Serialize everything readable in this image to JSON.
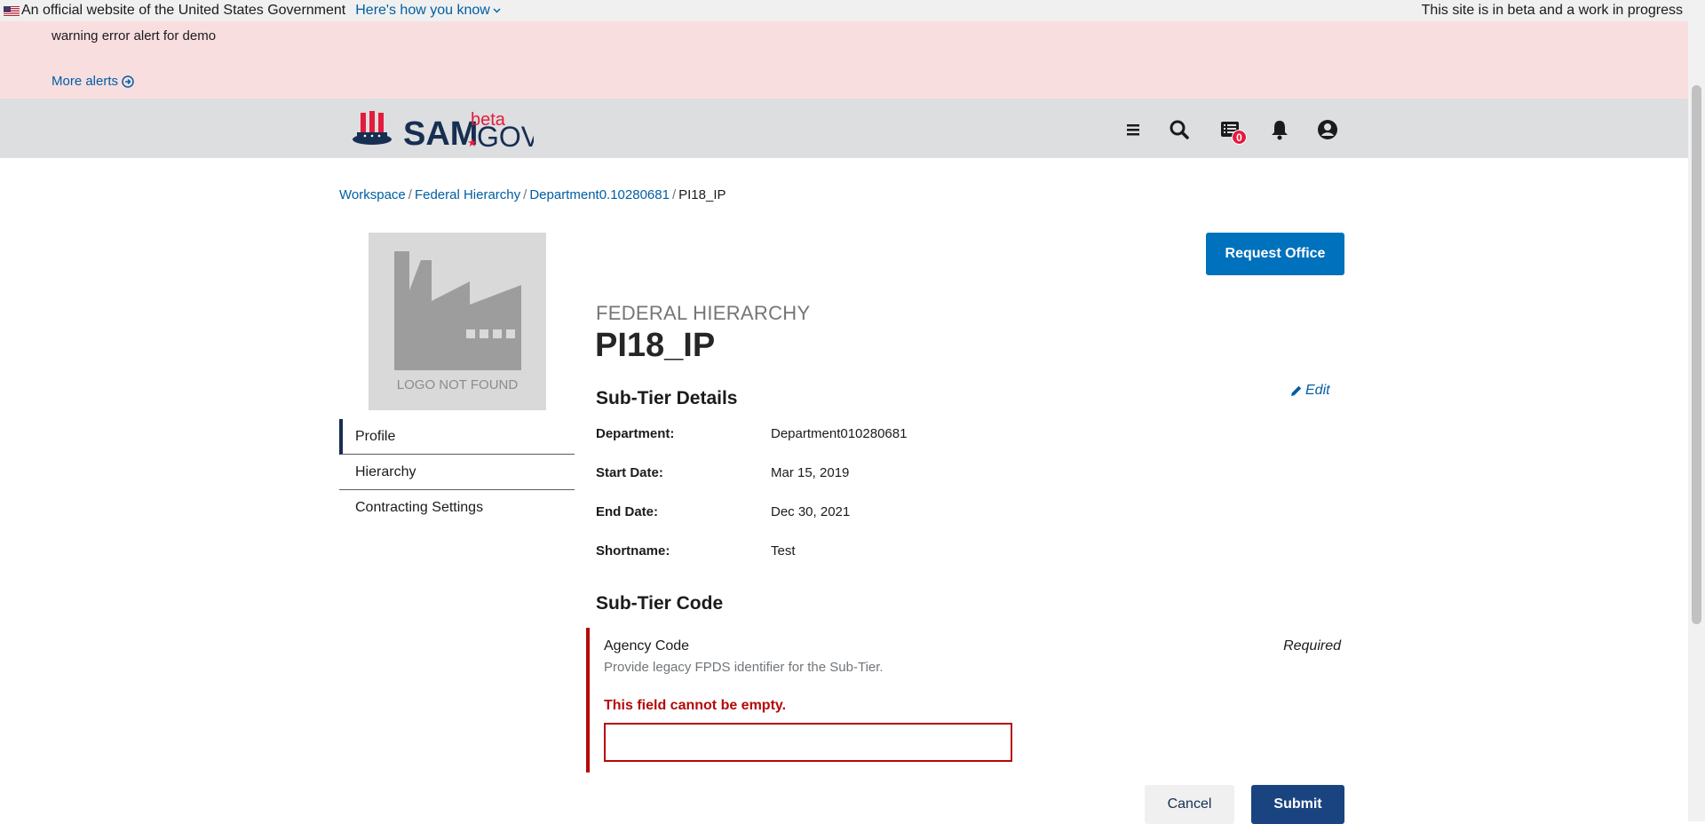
{
  "gov_banner": {
    "official_text": "An official website of the United States Government",
    "how_you_know": "Here's how you know",
    "beta_note": "This site is in beta and a work in progress"
  },
  "alert": {
    "message": "warning error alert for demo",
    "more_alerts": "More alerts"
  },
  "header": {
    "logo_text": "SAM",
    "logo_beta": "beta",
    "logo_gov": "GOV",
    "messages_count": "0",
    "icons": [
      "menu-icon",
      "search-icon",
      "messages-icon",
      "bell-icon",
      "user-icon"
    ]
  },
  "breadcrumb": {
    "items": [
      "Workspace",
      "Federal Hierarchy",
      "Department0.10280681"
    ],
    "current": "PI18_IP"
  },
  "sidebar": {
    "logo_placeholder": "LOGO NOT FOUND",
    "nav": [
      {
        "label": "Profile",
        "active": true
      },
      {
        "label": "Hierarchy",
        "active": false
      },
      {
        "label": "Contracting Settings",
        "active": false
      }
    ]
  },
  "main": {
    "request_office_label": "Request Office",
    "eyebrow": "FEDERAL HIERARCHY",
    "title": "PI18_IP",
    "details": {
      "heading": "Sub-Tier Details",
      "edit_label": "Edit",
      "rows": [
        {
          "key": "Department:",
          "value": "Department010280681"
        },
        {
          "key": "Start Date:",
          "value": "Mar 15, 2019"
        },
        {
          "key": "End Date:",
          "value": "Dec 30, 2021"
        },
        {
          "key": "Shortname:",
          "value": "Test"
        }
      ]
    },
    "code": {
      "heading": "Sub-Tier Code",
      "field_label": "Agency Code",
      "required_label": "Required",
      "hint": "Provide legacy FPDS identifier for the Sub-Tier.",
      "error": "This field cannot be empty.",
      "value": ""
    },
    "cancel_label": "Cancel",
    "submit_label": "Submit"
  },
  "colors": {
    "primary": "#0071bc",
    "navy": "#162e51",
    "error": "#b50909",
    "alert_bg": "#f9dee0",
    "header_bg": "#dcdee0",
    "logo_red": "#e31c3d"
  }
}
